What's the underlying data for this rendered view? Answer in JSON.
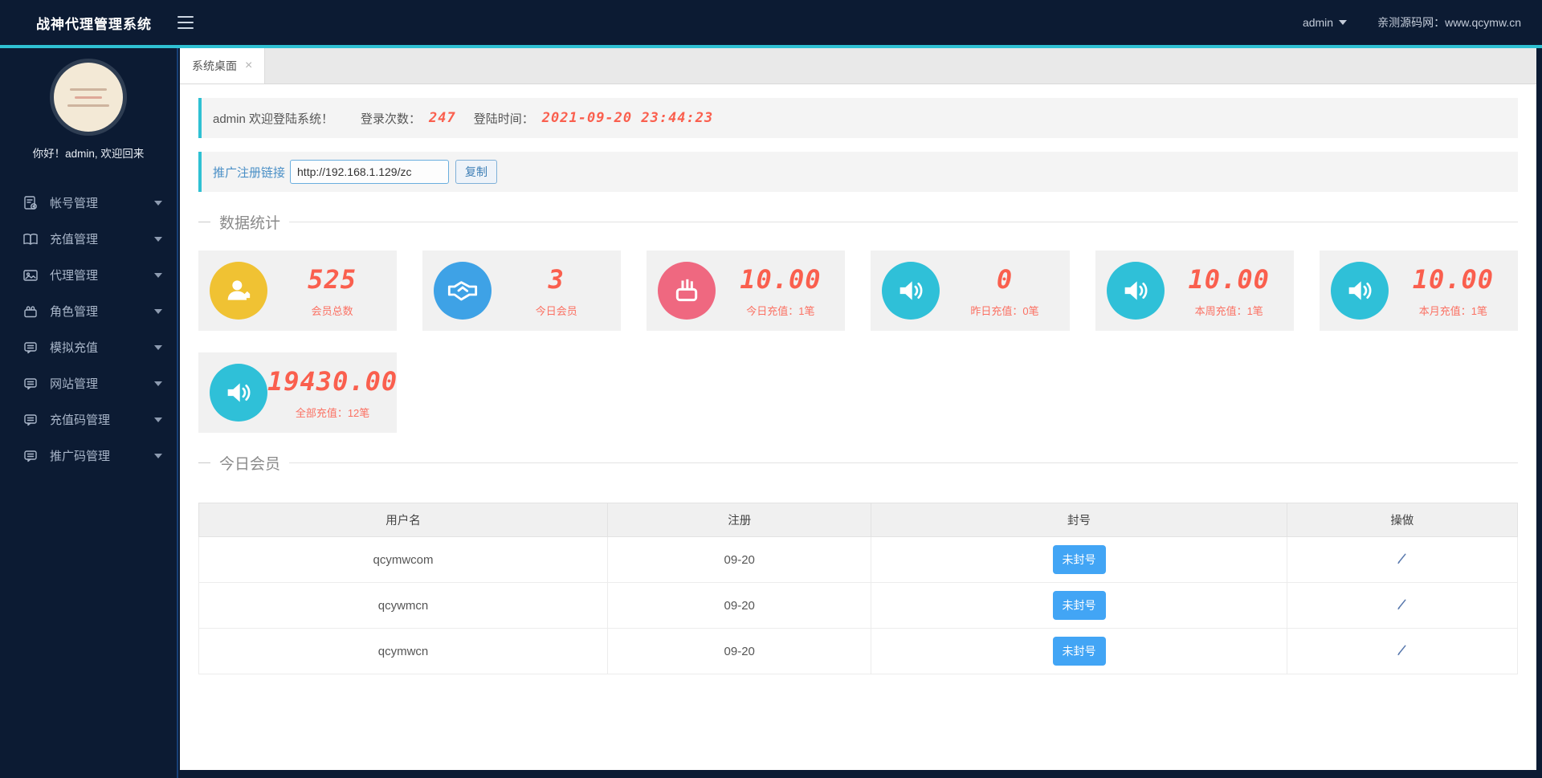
{
  "header": {
    "title": "战神代理管理系统",
    "user": "admin",
    "site_note": "亲测源码网：www.qcymw.cn"
  },
  "sidebar": {
    "greeting": "你好！admin, 欢迎回来",
    "items": [
      {
        "label": "帐号管理",
        "icon": "account-file-icon"
      },
      {
        "label": "充值管理",
        "icon": "open-book-icon"
      },
      {
        "label": "代理管理",
        "icon": "image-icon"
      },
      {
        "label": "角色管理",
        "icon": "basket-icon"
      },
      {
        "label": "模拟充值",
        "icon": "chat-bubble-icon"
      },
      {
        "label": "网站管理",
        "icon": "chat-bubble-icon"
      },
      {
        "label": "充值码管理",
        "icon": "chat-bubble-icon"
      },
      {
        "label": "推广码管理",
        "icon": "chat-bubble-icon"
      }
    ]
  },
  "tabbar": {
    "active_tab": "系统桌面",
    "close_glyph": "×"
  },
  "welcome": {
    "message": "admin 欢迎登陆系统！",
    "count_label": "登录次数：",
    "count_value": "247",
    "time_label": "登陆时间：",
    "time_value": "2021-09-20 23:44:23"
  },
  "promo": {
    "label": "推广注册链接",
    "url": "http://192.168.1.129/zc",
    "copy": "复制"
  },
  "stats": {
    "section_title": "数据统计",
    "cards": [
      {
        "value": "525",
        "label": "会员总数",
        "icon": "users-icon",
        "color": "#f0c233"
      },
      {
        "value": "3",
        "label": "今日会员",
        "icon": "handshake-icon",
        "color": "#3ea2e6"
      },
      {
        "value": "10.00",
        "label": "今日充值：1笔",
        "icon": "basket-icon",
        "color": "#ef6880"
      },
      {
        "value": "0",
        "label": "昨日充值：0笔",
        "icon": "speaker-icon",
        "color": "#2fc0d8"
      },
      {
        "value": "10.00",
        "label": "本周充值：1笔",
        "icon": "speaker-icon",
        "color": "#2fc0d8"
      },
      {
        "value": "10.00",
        "label": "本月充值：1笔",
        "icon": "speaker-icon",
        "color": "#2fc0d8"
      },
      {
        "value": "19430.00",
        "label": "全部充值：12笔",
        "icon": "speaker-icon",
        "color": "#2fc0d8"
      }
    ]
  },
  "members": {
    "section_title": "今日会员",
    "columns": [
      "用户名",
      "注册",
      "封号",
      "操做"
    ],
    "rows": [
      {
        "username": "qcymwcom",
        "registered": "09-20",
        "ban_status": "未封号"
      },
      {
        "username": "qcywmcn",
        "registered": "09-20",
        "ban_status": "未封号"
      },
      {
        "username": "qcymwcn",
        "registered": "09-20",
        "ban_status": "未封号"
      }
    ]
  },
  "colors": {
    "navy": "#0c1b33",
    "accent_cyan": "#2fc1d3",
    "lcd_red": "#fa5f4e",
    "button_blue": "#42a5f5"
  }
}
